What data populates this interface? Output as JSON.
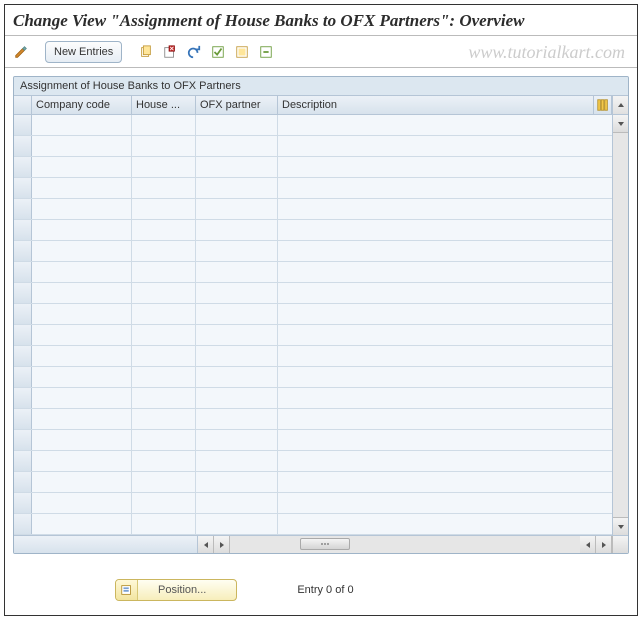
{
  "page_title": "Change View \"Assignment of House Banks to OFX Partners\": Overview",
  "watermark": "www.tutorialkart.com",
  "toolbar": {
    "new_entries_label": "New Entries"
  },
  "panel": {
    "title": "Assignment of House Banks to OFX Partners"
  },
  "columns": {
    "company_code": "Company code",
    "house": "House ...",
    "ofx_partner": "OFX partner",
    "description": "Description"
  },
  "rows": [
    {
      "company_code": "",
      "house": "",
      "ofx": "",
      "desc": ""
    },
    {
      "company_code": "",
      "house": "",
      "ofx": "",
      "desc": ""
    },
    {
      "company_code": "",
      "house": "",
      "ofx": "",
      "desc": ""
    },
    {
      "company_code": "",
      "house": "",
      "ofx": "",
      "desc": ""
    },
    {
      "company_code": "",
      "house": "",
      "ofx": "",
      "desc": ""
    },
    {
      "company_code": "",
      "house": "",
      "ofx": "",
      "desc": ""
    },
    {
      "company_code": "",
      "house": "",
      "ofx": "",
      "desc": ""
    },
    {
      "company_code": "",
      "house": "",
      "ofx": "",
      "desc": ""
    },
    {
      "company_code": "",
      "house": "",
      "ofx": "",
      "desc": ""
    },
    {
      "company_code": "",
      "house": "",
      "ofx": "",
      "desc": ""
    },
    {
      "company_code": "",
      "house": "",
      "ofx": "",
      "desc": ""
    },
    {
      "company_code": "",
      "house": "",
      "ofx": "",
      "desc": ""
    },
    {
      "company_code": "",
      "house": "",
      "ofx": "",
      "desc": ""
    },
    {
      "company_code": "",
      "house": "",
      "ofx": "",
      "desc": ""
    },
    {
      "company_code": "",
      "house": "",
      "ofx": "",
      "desc": ""
    },
    {
      "company_code": "",
      "house": "",
      "ofx": "",
      "desc": ""
    },
    {
      "company_code": "",
      "house": "",
      "ofx": "",
      "desc": ""
    },
    {
      "company_code": "",
      "house": "",
      "ofx": "",
      "desc": ""
    },
    {
      "company_code": "",
      "house": "",
      "ofx": "",
      "desc": ""
    },
    {
      "company_code": "",
      "house": "",
      "ofx": "",
      "desc": ""
    }
  ],
  "footer": {
    "position_label": "Position...",
    "entry_text": "Entry 0 of 0"
  }
}
